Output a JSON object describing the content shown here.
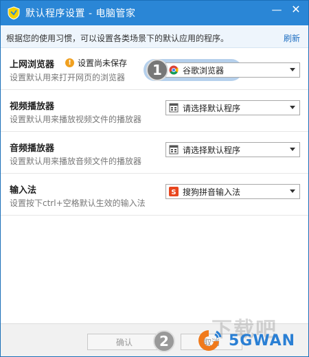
{
  "window": {
    "title": "默认程序设置 - 电脑管家",
    "minimize_glyph": "—",
    "close_glyph": "✕"
  },
  "hint": {
    "text": "根据您的使用习惯，可以设置各类场景下的默认应用的程序。",
    "refresh_label": "刷新"
  },
  "rows": [
    {
      "title": "上网浏览器",
      "desc": "设置默认用来打开网页的浏览器",
      "warning": "设置尚未保存",
      "selected": "谷歌浏览器",
      "icon": "chrome-icon"
    },
    {
      "title": "视频播放器",
      "desc": "设置默认用来播放视频文件的播放器",
      "selected": "请选择默认程序",
      "icon": "generic-app-icon"
    },
    {
      "title": "音频播放器",
      "desc": "设置默认用来播放音频文件的播放器",
      "selected": "请选择默认程序",
      "icon": "generic-app-icon"
    },
    {
      "title": "输入法",
      "desc": "设置按下ctrl+空格默认生效的输入法",
      "selected": "搜狗拼音输入法",
      "icon": "sogou-icon"
    }
  ],
  "steps": {
    "step1": "1",
    "step2": "2"
  },
  "footer": {
    "confirm_label": "确认",
    "cancel_label": "取消"
  },
  "watermark": {
    "site_text": "下载吧",
    "brand_text": "5GWAN"
  },
  "colors": {
    "titlebar": "#2a86d6",
    "link": "#1f6fc2",
    "warning": "#f0a020"
  }
}
